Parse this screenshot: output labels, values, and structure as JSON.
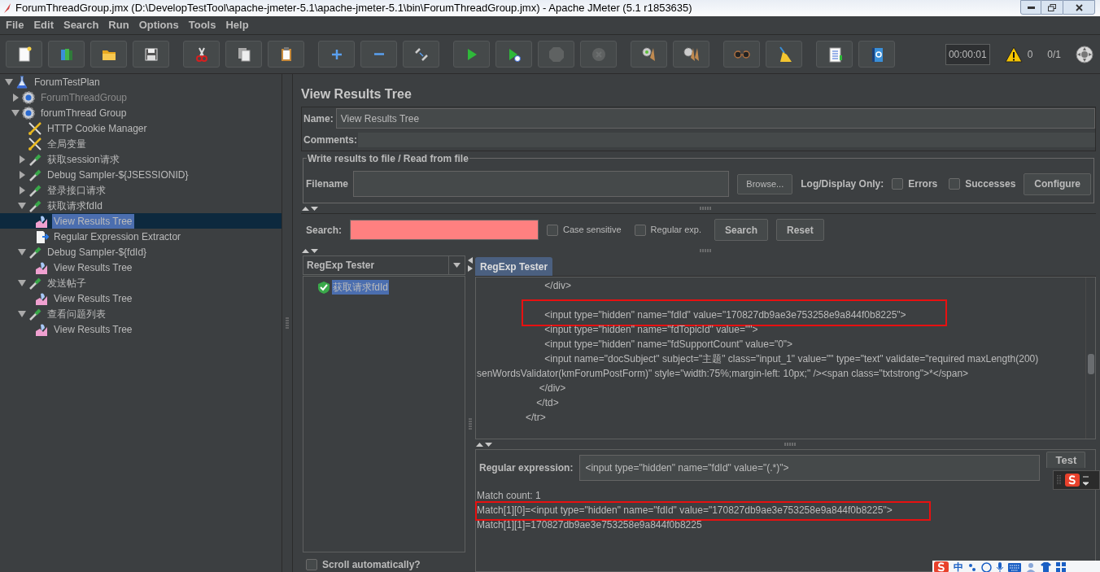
{
  "window": {
    "title": "ForumThreadGroup.jmx (D:\\DevelopTestTool\\apache-jmeter-5.1\\apache-jmeter-5.1\\bin\\ForumThreadGroup.jmx) - Apache JMeter (5.1 r1853635)"
  },
  "menu": [
    "File",
    "Edit",
    "Search",
    "Run",
    "Options",
    "Tools",
    "Help"
  ],
  "toolbar": [
    [
      {
        "kind": "new",
        "disabled": false
      },
      {
        "kind": "templates",
        "disabled": false
      },
      {
        "kind": "open",
        "disabled": false
      },
      {
        "kind": "save",
        "disabled": false
      }
    ],
    [
      {
        "kind": "cut",
        "disabled": false
      },
      {
        "kind": "copy",
        "disabled": false
      },
      {
        "kind": "paste",
        "disabled": false
      }
    ],
    [
      {
        "kind": "expand",
        "disabled": false
      },
      {
        "kind": "collapse",
        "disabled": false
      },
      {
        "kind": "toggle",
        "disabled": false
      }
    ],
    [
      {
        "kind": "start",
        "disabled": false
      },
      {
        "kind": "start_no_pauses",
        "disabled": false
      },
      {
        "kind": "stop",
        "disabled": true
      },
      {
        "kind": "shutdown",
        "disabled": true
      }
    ],
    [
      {
        "kind": "clear",
        "disabled": false
      },
      {
        "kind": "clear_all",
        "disabled": false
      }
    ],
    [
      {
        "kind": "search",
        "disabled": false
      },
      {
        "kind": "reset_search",
        "disabled": false
      }
    ],
    [
      {
        "kind": "function_helper",
        "disabled": false
      },
      {
        "kind": "help",
        "disabled": false
      }
    ]
  ],
  "status": {
    "timer": "00:00:01",
    "warnings": "0",
    "threads": "0/1"
  },
  "tree": [
    {
      "label": "ForumTestPlan",
      "kind": "test_plan",
      "expanded": true,
      "disabled": false,
      "selected": false,
      "children": [
        {
          "label": "ForumThreadGroup",
          "kind": "thread_group",
          "expanded": false,
          "disabled": true,
          "selected": false
        },
        {
          "label": "forumThread Group",
          "kind": "thread_group",
          "expanded": true,
          "disabled": false,
          "selected": false,
          "children": [
            {
              "label": "HTTP Cookie Manager",
              "kind": "config",
              "disabled": false,
              "selected": false
            },
            {
              "label": "全局变量",
              "kind": "config",
              "disabled": false,
              "selected": false
            },
            {
              "label": "获取session请求",
              "kind": "sampler",
              "expanded": false,
              "disabled": false,
              "selected": false
            },
            {
              "label": "Debug Sampler-${JSESSIONID}",
              "kind": "sampler",
              "expanded": false,
              "disabled": false,
              "selected": false
            },
            {
              "label": "登录接口请求",
              "kind": "sampler",
              "expanded": false,
              "disabled": false,
              "selected": false
            },
            {
              "label": "获取请求fdId",
              "kind": "sampler",
              "expanded": true,
              "disabled": false,
              "selected": false,
              "children": [
                {
                  "label": "View Results Tree",
                  "kind": "listener",
                  "disabled": false,
                  "selected": true
                },
                {
                  "label": "Regular Expression Extractor",
                  "kind": "extractor",
                  "disabled": false,
                  "selected": false
                }
              ]
            },
            {
              "label": "Debug Sampler-${fdId}",
              "kind": "sampler",
              "expanded": true,
              "disabled": false,
              "selected": false,
              "children": [
                {
                  "label": "View Results Tree",
                  "kind": "listener",
                  "disabled": false,
                  "selected": false
                }
              ]
            },
            {
              "label": "发送帖子",
              "kind": "sampler",
              "expanded": true,
              "disabled": false,
              "selected": false,
              "children": [
                {
                  "label": "View Results Tree",
                  "kind": "listener",
                  "disabled": false,
                  "selected": false
                }
              ]
            },
            {
              "label": "查看问题列表",
              "kind": "sampler",
              "expanded": true,
              "disabled": false,
              "selected": false,
              "children": [
                {
                  "label": "View Results Tree",
                  "kind": "listener",
                  "disabled": false,
                  "selected": false
                }
              ]
            }
          ]
        }
      ]
    }
  ],
  "panel": {
    "title": "View Results Tree",
    "name_label": "Name:",
    "name_value": "View Results Tree",
    "comments_label": "Comments:",
    "file_group": {
      "legend": "Write results to file / Read from file",
      "filename_label": "Filename",
      "browse": "Browse...",
      "log_label": "Log/Display Only:",
      "options": [
        {
          "label": "Errors",
          "checked": false
        },
        {
          "label": "Successes",
          "checked": false
        }
      ],
      "configure": "Configure"
    },
    "search": {
      "label": "Search:",
      "invalid": true,
      "options": [
        {
          "label": "Case sensitive",
          "checked": false
        },
        {
          "label": "Regular exp.",
          "checked": false
        }
      ],
      "search_button": "Search",
      "reset_button": "Reset"
    },
    "renderer": "RegExp Tester",
    "results": [
      {
        "label": "获取请求fdId",
        "success": true,
        "selected": true
      }
    ],
    "scroll_auto": {
      "label": "Scroll automatically?",
      "checked": false
    },
    "tabs": [
      {
        "label": "RegExp Tester",
        "selected": true
      }
    ],
    "response_lines": [
      {
        "text": "                         </div>",
        "highlighted": false,
        "blank_before": false
      },
      {
        "text": "                         <input type=\"hidden\" name=\"fdId\" value=\"170827db9ae3e753258e9a844f0b8225\">",
        "highlighted": true,
        "blank_before": true
      },
      {
        "text": "                         <input type=\"hidden\" name=\"fdTopicId\" value=\"\">",
        "highlighted": false,
        "blank_before": false
      },
      {
        "text": "                         <input type=\"hidden\" name=\"fdSupportCount\" value=\"0\">",
        "highlighted": false,
        "blank_before": false
      },
      {
        "text": "                         <input name=\"docSubject\" subject=\"主题\" class=\"input_1\" value=\"\" type=\"text\" validate=\"required maxLength(200)",
        "highlighted": false,
        "blank_before": false
      },
      {
        "text": "senWordsValidator(kmForumPostForm)\" style=\"width:75%;margin-left: 10px;\" /><span class=\"txtstrong\">*</span>",
        "highlighted": false,
        "blank_before": false
      },
      {
        "text": "                       </div>",
        "highlighted": false,
        "blank_before": false
      },
      {
        "text": "                      </td>",
        "highlighted": false,
        "blank_before": false
      },
      {
        "text": "                  </tr>",
        "highlighted": false,
        "blank_before": false
      }
    ],
    "regex": {
      "label": "Regular expression:",
      "value": "<input type=\"hidden\" name=\"fdId\" value=\"(.*)\">",
      "test_button": "Test"
    },
    "matches": [
      {
        "text": "Match count: 1",
        "highlighted": false
      },
      {
        "text": "Match[1][0]=<input type=\"hidden\" name=\"fdId\" value=\"170827db9ae3e753258e9a844f0b8225\">",
        "highlighted": true
      },
      {
        "text": "Match[1][1]=170827db9ae3e753258e9a844f0b8225",
        "highlighted": false
      }
    ]
  },
  "ime": {
    "label": "中"
  }
}
